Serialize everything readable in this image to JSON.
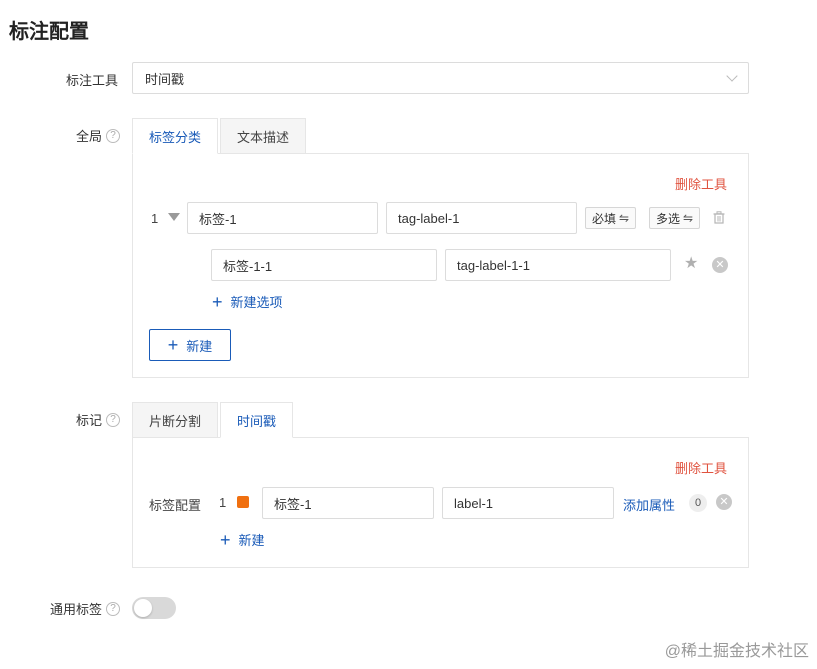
{
  "page": {
    "title": "标注配置"
  },
  "tool_row": {
    "label": "标注工具",
    "selected": "时间戳"
  },
  "global": {
    "label": "全局",
    "help_icon": "question-circle-icon",
    "tabs": [
      {
        "label": "标签分类",
        "active": true
      },
      {
        "label": "文本描述",
        "active": false
      }
    ],
    "delete_tool": "删除工具",
    "item": {
      "index": "1",
      "name": "标签-1",
      "value": "tag-label-1",
      "required_btn": "必填",
      "multi_btn": "多选",
      "swap_glyph": "⇋",
      "option": {
        "name": "标签-1-1",
        "value": "tag-label-1-1"
      }
    },
    "new_option": "新建选项",
    "new_button": "新建"
  },
  "mark": {
    "label": "标记",
    "help_icon": "question-circle-icon",
    "tabs": [
      {
        "label": "片断分割",
        "active": false
      },
      {
        "label": "时间戳",
        "active": true
      }
    ],
    "delete_tool": "删除工具",
    "config_label": "标签配置",
    "index": "1",
    "swatch_color": "#f07010",
    "name": "标签-1",
    "value": "label-1",
    "add_attr": "添加属性",
    "attr_count": "0",
    "new_link": "新建"
  },
  "general": {
    "label": "通用标签",
    "help_icon": "question-circle-icon",
    "toggle_on": false
  },
  "watermark": "@稀土掘金技术社区",
  "colors": {
    "accent": "#1a5bb8",
    "danger": "#e0533f"
  }
}
